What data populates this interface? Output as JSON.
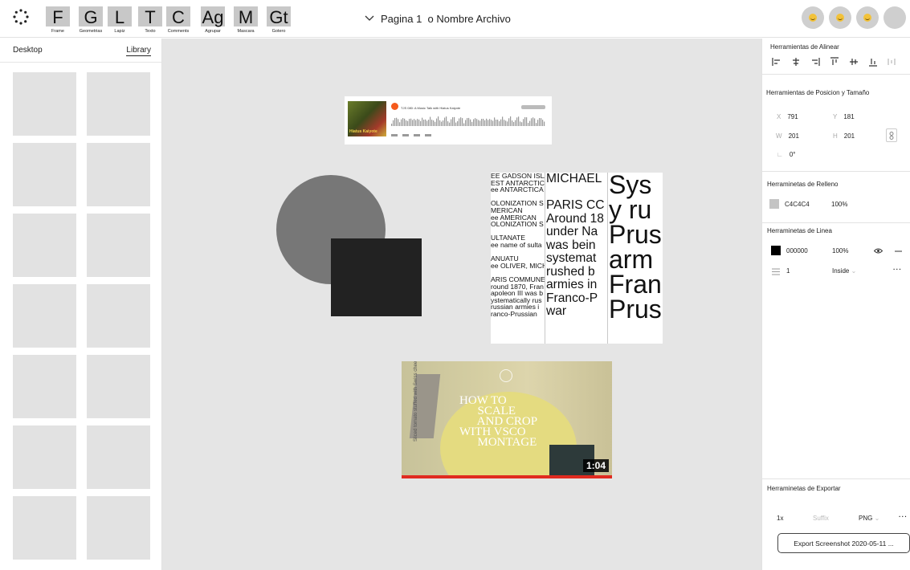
{
  "toolbar": {
    "tools": [
      {
        "glyph": "F",
        "label": "Frame"
      },
      {
        "glyph": "G",
        "label": "Geometrias"
      },
      {
        "glyph": "L",
        "label": "Lapiz"
      },
      {
        "glyph": "T",
        "label": "Texto"
      },
      {
        "glyph": "C",
        "label": "Comments"
      },
      {
        "glyph": "Ag",
        "label": "Agrupar"
      },
      {
        "glyph": "M",
        "label": "Mascara"
      },
      {
        "glyph": "Gt",
        "label": "Gotero"
      }
    ],
    "page_title": "Pagina 1  o Nombre Archivo",
    "avatar_count": 4
  },
  "left_panel": {
    "tab_desktop": "Desktop",
    "tab_library": "Library",
    "active_tab": "Library",
    "thumbnail_count": 14
  },
  "canvas": {
    "audio_card": {
      "title": "TJS 080: A Music Talk with Hiatus Kaiyote",
      "art_text": "Hiatus Kaiyote"
    },
    "type_sheet": {
      "col1": [
        "EE GADSON ISLAN",
        "EST ANTARCTIC",
        "ee ANTARCTICA",
        "",
        "OLONIZATION S",
        "MERICAN",
        "ee AMERICAN",
        "OLONIZATION S",
        "",
        "ULTANATE",
        "ee name of sulta",
        "",
        "ANUATU",
        "ee OLIVER, MICH",
        "",
        "ARIS COMMUNE",
        "round 1870, Fran",
        "apoleon III was b",
        "ystematically rus",
        "russian armies i",
        "ranco-Prussian"
      ],
      "col2": [
        "MICHAEL",
        "",
        "PARIS CC",
        "Around 18",
        "under Na",
        "was bein",
        "systemat",
        "rushed b",
        "armies in",
        "Franco-P",
        "war"
      ],
      "col3": [
        "Sys",
        "y ru",
        "Prus",
        "arm",
        "Fran",
        "Prus"
      ]
    },
    "video": {
      "title": "HOW TO\n      SCALE\n      AND CROP\nWITH VSCO\n      MONTAGE",
      "side_text": "Sliced tomato stuffed with Swiss cheese",
      "duration": "1:04"
    }
  },
  "right_panel": {
    "align": {
      "title": "Herramientas de Alinear"
    },
    "position": {
      "title": "Herramientas de Posicion y Tamaño",
      "x_label": "X",
      "x": "791",
      "y_label": "Y",
      "y": "181",
      "w_label": "W",
      "w": "201",
      "h_label": "H",
      "h": "201",
      "rotation": "0°"
    },
    "fill": {
      "title": "Herraminetas de Relleno",
      "color": "C4C4C4",
      "color_hex": "#C4C4C4",
      "opacity": "100%"
    },
    "stroke": {
      "title": "Herraminetas de Linea",
      "color": "000000",
      "color_hex": "#000000",
      "opacity": "100%",
      "width": "1",
      "position": "Inside"
    },
    "export": {
      "title": "Herraminetas de Exportar",
      "scale": "1x",
      "suffix_placeholder": "Suffix",
      "format": "PNG",
      "button": "Export Screenshot 2020-05-11 ..."
    }
  }
}
